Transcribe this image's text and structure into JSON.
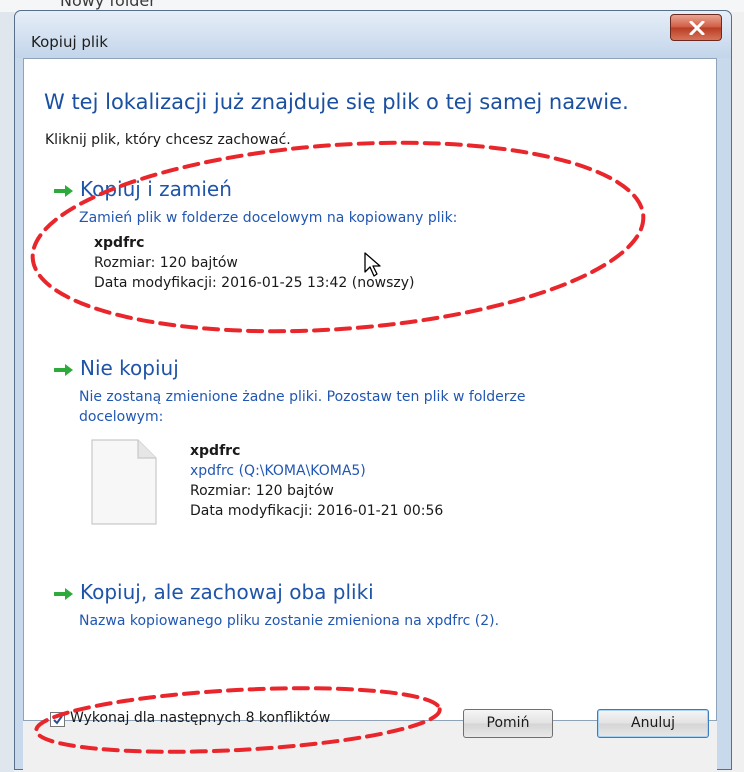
{
  "background": {
    "partial_text": "Nowy folder"
  },
  "window": {
    "title": "Kopiuj plik"
  },
  "main": {
    "heading": "W tej lokalizacji już znajduje się plik o tej samej nazwie.",
    "subtext": "Kliknij plik, który chcesz zachować."
  },
  "options": [
    {
      "title": "Kopiuj i zamień",
      "description": "Zamień plik w folderze docelowym na kopiowany plik:",
      "file": {
        "name": "xpdfrc",
        "size": "Rozmiar: 120 bajtów",
        "modified": "Data modyfikacji: 2016-01-25 13:42 (nowszy)"
      }
    },
    {
      "title": "Nie kopiuj",
      "description_line1": "Nie zostaną zmienione żadne pliki. Pozostaw ten plik w folderze",
      "description_line2": "docelowym:",
      "file": {
        "name": "xpdfrc",
        "path": "xpdfrc (Q:\\KOMA\\KOMA5)",
        "size": "Rozmiar: 120 bajtów",
        "modified": "Data modyfikacji: 2016-01-21 00:56"
      }
    },
    {
      "title": "Kopiuj, ale zachowaj oba pliki",
      "description": "Nazwa kopiowanego pliku zostanie zmieniona na xpdfrc (2)."
    }
  ],
  "footer": {
    "checkbox_label": "Wykonaj dla następnych 8 konfliktów",
    "checkbox_checked": true,
    "skip_label": "Pomiń",
    "cancel_label": "Anuluj"
  },
  "colors": {
    "link_blue": "#1f55a8",
    "annotation_red": "#e8262b",
    "arrow_green": "#2eaa3c"
  },
  "icons": {
    "close": "close-icon",
    "arrow": "green-arrow-icon",
    "document": "document-icon",
    "cursor": "mouse-cursor-icon",
    "check": "checkmark-icon"
  }
}
